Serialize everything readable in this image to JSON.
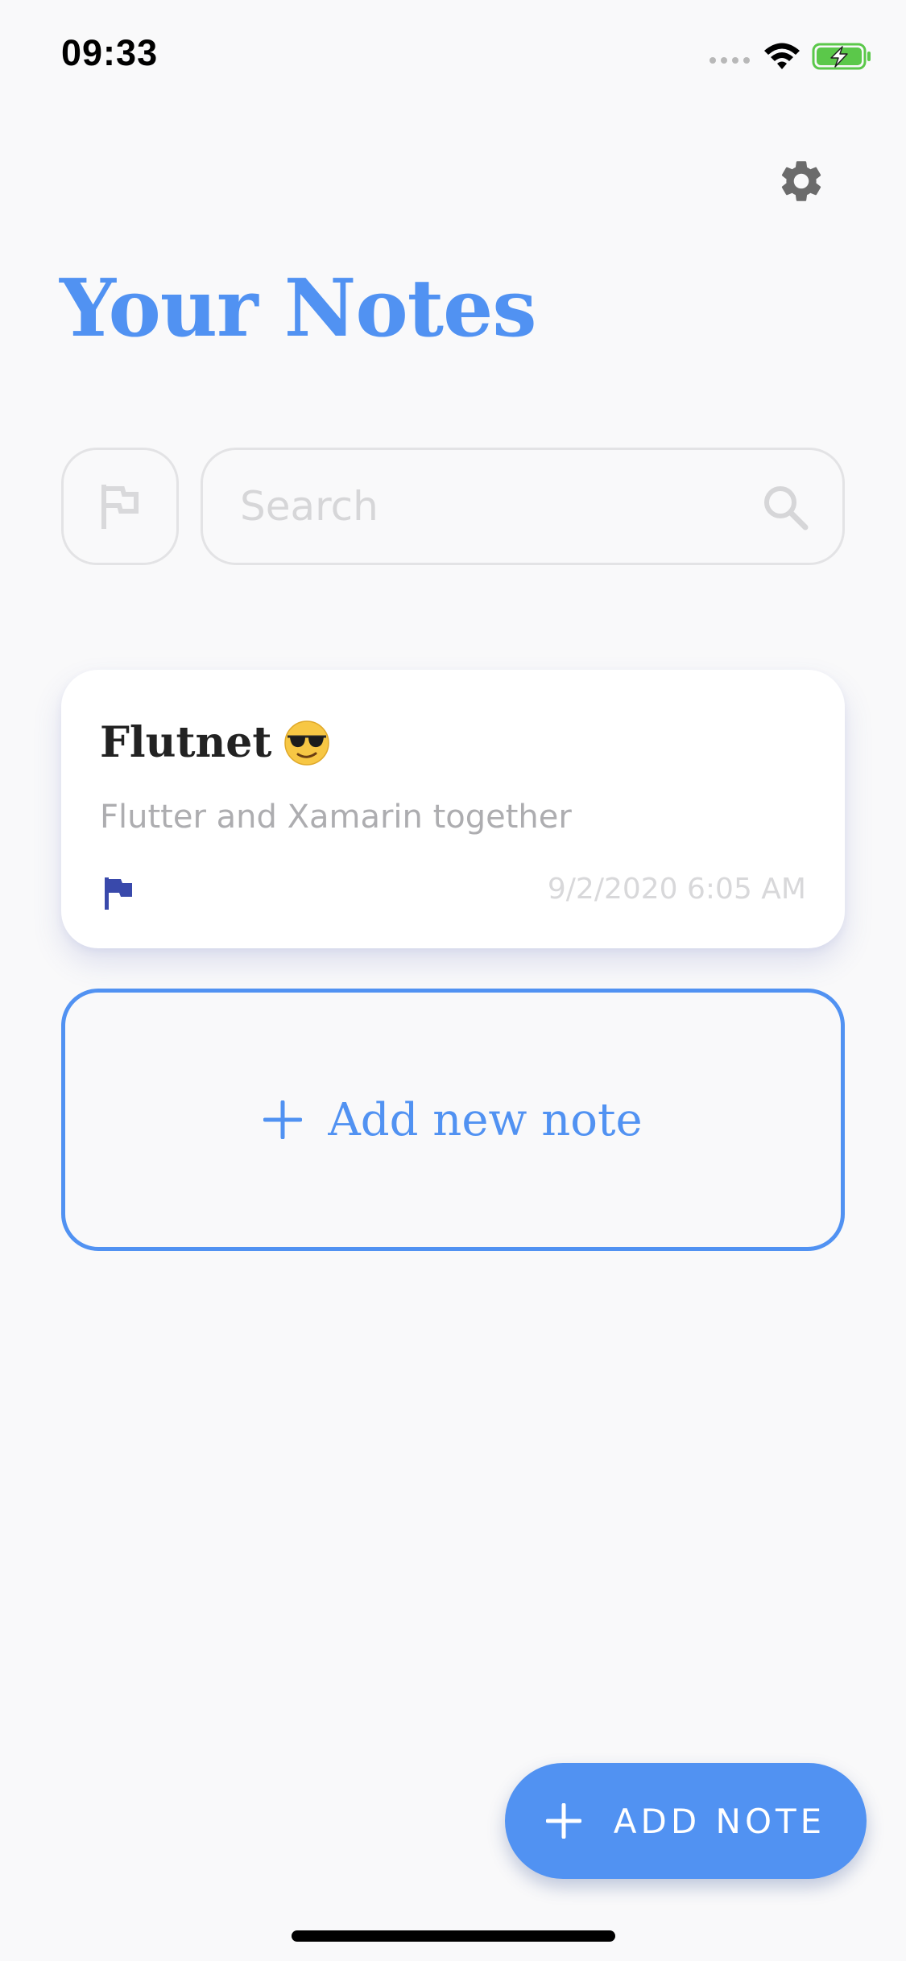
{
  "status_bar": {
    "time": "09:33",
    "signal_icon": "signal-icon",
    "wifi_icon": "wifi-icon",
    "battery_icon": "battery-charging-icon"
  },
  "header": {
    "settings_icon": "gear-icon",
    "title": "Your Notes"
  },
  "filter": {
    "flag_icon": "flag-outline-icon"
  },
  "search": {
    "placeholder": "Search",
    "value": "",
    "icon": "search-icon"
  },
  "notes": [
    {
      "title": "Flutnet",
      "emoji": "smiling-face-with-sunglasses",
      "body": "Flutter and Xamarin together",
      "flagged": true,
      "date": "9/2/2020 6:05 AM"
    }
  ],
  "add_tile": {
    "label": "Add new note",
    "icon": "plus-icon"
  },
  "fab": {
    "label": "ADD NOTE",
    "icon": "plus-icon"
  },
  "colors": {
    "accent": "#5192f2",
    "background": "#f9f9fa",
    "card": "#ffffff",
    "flag": "#3949ab",
    "battery": "#5bc84a"
  }
}
